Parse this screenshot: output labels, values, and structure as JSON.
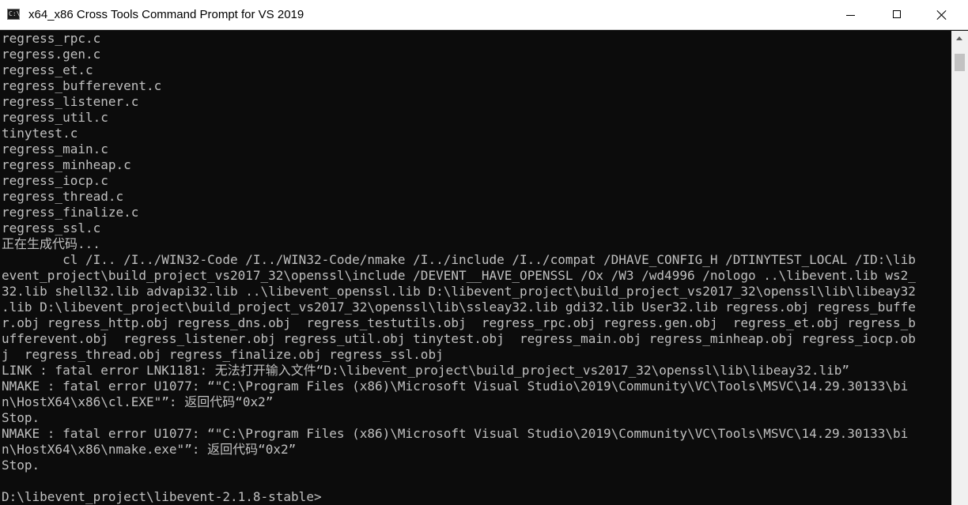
{
  "window": {
    "title": "x64_x86 Cross Tools Command Prompt for VS 2019",
    "icon_glyph": "C:\\",
    "controls": {
      "minimize": "minimize-icon",
      "maximize": "maximize-icon",
      "close": "close-icon"
    }
  },
  "colors": {
    "console_background": "#0c0c0c",
    "console_text": "#c0c0c0",
    "titlebar_background": "#ffffff"
  },
  "console": {
    "lines": [
      "regress_rpc.c",
      "regress.gen.c",
      "regress_et.c",
      "regress_bufferevent.c",
      "regress_listener.c",
      "regress_util.c",
      "tinytest.c",
      "regress_main.c",
      "regress_minheap.c",
      "regress_iocp.c",
      "regress_thread.c",
      "regress_finalize.c",
      "regress_ssl.c",
      "正在生成代码...",
      "        cl /I.. /I../WIN32-Code /I../WIN32-Code/nmake /I../include /I../compat /DHAVE_CONFIG_H /DTINYTEST_LOCAL /ID:\\lib",
      "event_project\\build_project_vs2017_32\\openssl\\include /DEVENT__HAVE_OPENSSL /Ox /W3 /wd4996 /nologo ..\\libevent.lib ws2_",
      "32.lib shell32.lib advapi32.lib ..\\libevent_openssl.lib D:\\libevent_project\\build_project_vs2017_32\\openssl\\lib\\libeay32",
      ".lib D:\\libevent_project\\build_project_vs2017_32\\openssl\\lib\\ssleay32.lib gdi32.lib User32.lib regress.obj regress_buffe",
      "r.obj regress_http.obj regress_dns.obj  regress_testutils.obj  regress_rpc.obj regress.gen.obj  regress_et.obj regress_b",
      "ufferevent.obj  regress_listener.obj regress_util.obj tinytest.obj  regress_main.obj regress_minheap.obj regress_iocp.ob",
      "j  regress_thread.obj regress_finalize.obj regress_ssl.obj",
      "LINK : fatal error LNK1181: 无法打开输入文件“D:\\libevent_project\\build_project_vs2017_32\\openssl\\lib\\libeay32.lib”",
      "NMAKE : fatal error U1077: “\"C:\\Program Files (x86)\\Microsoft Visual Studio\\2019\\Community\\VC\\Tools\\MSVC\\14.29.30133\\bi",
      "n\\HostX64\\x86\\cl.EXE\"”: 返回代码“0x2”",
      "Stop.",
      "NMAKE : fatal error U1077: “\"C:\\Program Files (x86)\\Microsoft Visual Studio\\2019\\Community\\VC\\Tools\\MSVC\\14.29.30133\\bi",
      "n\\HostX64\\x86\\nmake.exe\"”: 返回代码“0x2”",
      "Stop.",
      "",
      "D:\\libevent_project\\libevent-2.1.8-stable>"
    ]
  },
  "scrollbar": {
    "up_arrow": "chevron-up-icon",
    "position_fraction": 0.97
  }
}
